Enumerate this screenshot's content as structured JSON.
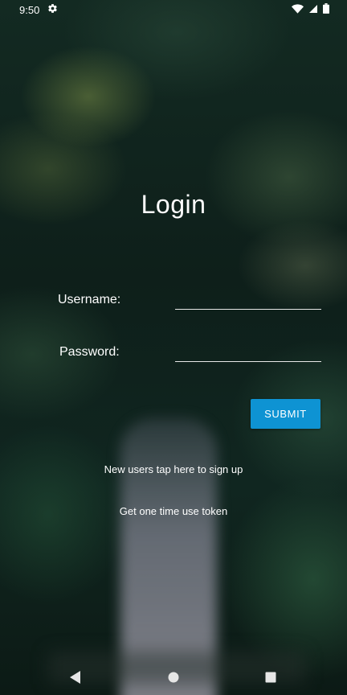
{
  "status_bar": {
    "time": "9:50",
    "icons": [
      "gear-icon",
      "wifi-icon",
      "signal-icon",
      "battery-icon"
    ]
  },
  "login": {
    "title": "Login",
    "username_label": "Username:",
    "username_value": "",
    "password_label": "Password:",
    "password_value": "",
    "submit_label": "SUBMIT",
    "signup_link": "New users tap here to sign up",
    "token_link": "Get one time use token"
  },
  "nav_bar": {
    "icons": [
      "back-icon",
      "home-icon",
      "recents-icon"
    ]
  },
  "colors": {
    "accent": "#0e93d3",
    "text": "#ffffff"
  }
}
